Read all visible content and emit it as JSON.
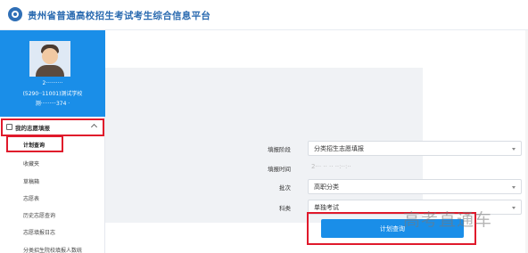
{
  "header": {
    "title": "贵州省普通高校招生考试考生综合信息平台"
  },
  "profile": {
    "id_text": "2··········",
    "school_text": "(5290··11001)测试学校",
    "extra_text": "测·········374 ·"
  },
  "sidebar": {
    "group_label": "我的志愿填报",
    "items": [
      {
        "label": "计划查询"
      },
      {
        "label": "收藏夹"
      },
      {
        "label": "草稿箱"
      },
      {
        "label": "志愿表"
      },
      {
        "label": "历史志愿查询"
      },
      {
        "label": "志愿填报日志"
      },
      {
        "label": "分类招生院校填报人数统"
      }
    ]
  },
  "form": {
    "stage_label": "填报阶段",
    "stage_value": "分类招生志愿填报",
    "time_label": "填报时间",
    "time_value": "2··· ·· ··     ··:··:··",
    "batch_label": "批次",
    "batch_value": "高职分类",
    "subject_label": "科类",
    "subject_value": "单独考试",
    "query_button": "计划查询"
  },
  "watermark": "高考直通车",
  "colors": {
    "brand_blue": "#1a8ee8",
    "title_blue": "#2a6ab0",
    "highlight_red": "#e0192b"
  }
}
